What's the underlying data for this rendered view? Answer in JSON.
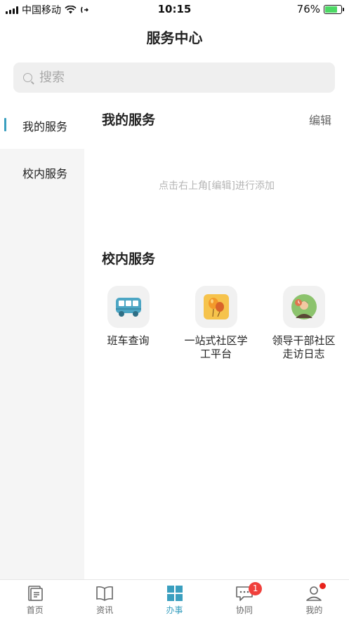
{
  "status_bar": {
    "carrier": "中国移动",
    "time": "10:15",
    "battery": "76%",
    "battery_level": 0.76
  },
  "header": {
    "title": "服务中心"
  },
  "search": {
    "placeholder": "搜索"
  },
  "sidebar": {
    "items": [
      {
        "label": "我的服务",
        "active": true
      },
      {
        "label": "校内服务",
        "active": false
      }
    ]
  },
  "my_services": {
    "title": "我的服务",
    "edit_label": "编辑",
    "empty_hint": "点击右上角[编辑]进行添加"
  },
  "campus_services": {
    "title": "校内服务",
    "items": [
      {
        "label": "班车查询",
        "icon": "bus-icon"
      },
      {
        "label": "一站式社区学工平台",
        "icon": "balloons-icon"
      },
      {
        "label": "领导干部社区走访日志",
        "icon": "leader-visit-icon"
      }
    ]
  },
  "tabbar": {
    "tabs": [
      {
        "label": "首页",
        "icon": "home-doc-icon"
      },
      {
        "label": "资讯",
        "icon": "book-icon"
      },
      {
        "label": "办事",
        "icon": "grid-icon",
        "active": true
      },
      {
        "label": "协同",
        "icon": "chat-icon",
        "badge": "1"
      },
      {
        "label": "我的",
        "icon": "user-icon"
      }
    ]
  },
  "colors": {
    "accent": "#3a9fbf",
    "badge": "#f0403c",
    "sidebar_bg": "#f5f5f5"
  }
}
